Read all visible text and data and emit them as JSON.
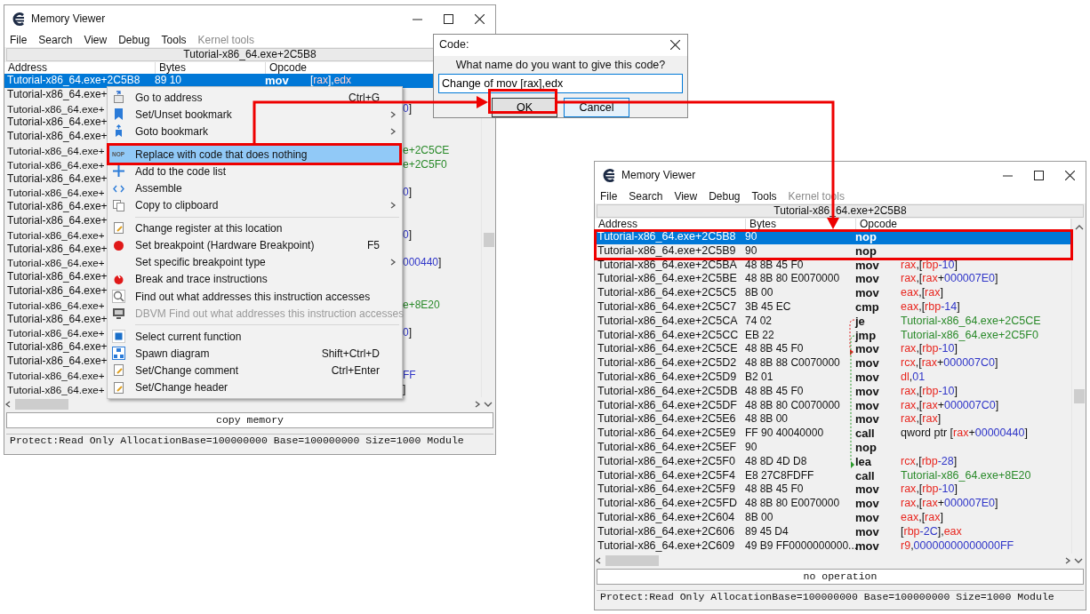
{
  "left_window": {
    "title": "Memory Viewer",
    "menu": [
      {
        "label": "File",
        "disabled": false
      },
      {
        "label": "Search",
        "disabled": false
      },
      {
        "label": "View",
        "disabled": false
      },
      {
        "label": "Debug",
        "disabled": false
      },
      {
        "label": "Tools",
        "disabled": false
      },
      {
        "label": "Kernel tools",
        "disabled": true
      }
    ],
    "address_bar": "Tutorial-x86_64.exe+2C5B8",
    "columns": [
      "Address",
      "Bytes",
      "Opcode"
    ],
    "rows": [
      {
        "address": "Tutorial-x86_64.exe+2C5B8",
        "bytes": "89 10",
        "opcode": "mov",
        "operand": [
          {
            "text": "[",
            "kind": "plain"
          },
          {
            "text": "rax",
            "kind": "reg"
          },
          {
            "text": "],",
            "kind": "plain"
          },
          {
            "text": "edx",
            "kind": "reg"
          }
        ],
        "selected": true
      },
      {
        "address": "Tutorial-x86_64.exe+",
        "selected": false
      },
      {
        "address": "Tutorial-x86_64.exe+",
        "tail": [
          {
            "text": "0",
            "kind": "num"
          },
          {
            "text": "]",
            "kind": "plain"
          }
        ],
        "selected": false
      },
      {
        "address": "Tutorial-x86_64.exe+",
        "selected": false
      },
      {
        "address": "Tutorial-x86_64.exe+",
        "selected": false
      },
      {
        "address": "Tutorial-x86_64.exe+",
        "tail": [
          {
            "text": "e+2C5CE",
            "kind": "label"
          }
        ],
        "selected": false
      },
      {
        "address": "Tutorial-x86_64.exe+",
        "tail": [
          {
            "text": "e+2C5F0",
            "kind": "label"
          }
        ],
        "selected": false
      },
      {
        "address": "Tutorial-x86_64.exe+",
        "selected": false
      },
      {
        "address": "Tutorial-x86_64.exe+",
        "tail": [
          {
            "text": "0",
            "kind": "num"
          },
          {
            "text": "]",
            "kind": "plain"
          }
        ],
        "selected": false
      },
      {
        "address": "Tutorial-x86_64.exe+",
        "selected": false
      },
      {
        "address": "Tutorial-x86_64.exe+",
        "selected": false
      },
      {
        "address": "Tutorial-x86_64.exe+",
        "tail": [
          {
            "text": "0",
            "kind": "num"
          },
          {
            "text": "]",
            "kind": "plain"
          }
        ],
        "selected": false
      },
      {
        "address": "Tutorial-x86_64.exe+",
        "selected": false
      },
      {
        "address": "Tutorial-x86_64.exe+",
        "tail": [
          {
            "text": "000440",
            "kind": "num"
          },
          {
            "text": "]",
            "kind": "plain"
          }
        ],
        "selected": false
      },
      {
        "address": "Tutorial-x86_64.exe+",
        "selected": false
      },
      {
        "address": "Tutorial-x86_64.exe+",
        "selected": false
      },
      {
        "address": "Tutorial-x86_64.exe+",
        "tail": [
          {
            "text": "e+8E20",
            "kind": "label"
          }
        ],
        "selected": false
      },
      {
        "address": "Tutorial-x86_64.exe+",
        "selected": false
      },
      {
        "address": "Tutorial-x86_64.exe+",
        "tail": [
          {
            "text": "0",
            "kind": "num"
          },
          {
            "text": "]",
            "kind": "plain"
          }
        ],
        "selected": false
      },
      {
        "address": "Tutorial-x86_64.exe+",
        "selected": false
      },
      {
        "address": "Tutorial-x86_64.exe+",
        "selected": false
      },
      {
        "address": "Tutorial-x86_64.exe+",
        "tail": [
          {
            "text": "FF",
            "kind": "num"
          }
        ],
        "selected": false
      },
      {
        "address": "Tutorial-x86_64.exe+",
        "tail": [
          {
            "text": "]",
            "kind": "plain"
          }
        ],
        "selected": false
      }
    ],
    "description": "copy memory",
    "status": "Protect:Read Only  AllocationBase=100000000 Base=100000000 Size=1000 Module"
  },
  "context_menu": [
    {
      "kind": "item",
      "label": "Go to address",
      "shortcut": "Ctrl+G",
      "submenu": false,
      "disabled": false,
      "selected": false
    },
    {
      "kind": "item",
      "label": "Set/Unset bookmark",
      "submenu": true,
      "disabled": false,
      "selected": false
    },
    {
      "kind": "item",
      "label": "Goto bookmark",
      "submenu": true,
      "disabled": false,
      "selected": false
    },
    {
      "kind": "separator"
    },
    {
      "kind": "item",
      "label": "Replace with code that does nothing",
      "icon_text": "NOP",
      "submenu": false,
      "disabled": false,
      "selected": true
    },
    {
      "kind": "item",
      "label": "Add to the code list",
      "submenu": false,
      "disabled": false,
      "selected": false
    },
    {
      "kind": "item",
      "label": "Assemble",
      "submenu": false,
      "disabled": false,
      "selected": false
    },
    {
      "kind": "item",
      "label": "Copy to clipboard",
      "submenu": true,
      "disabled": false,
      "selected": false
    },
    {
      "kind": "separator"
    },
    {
      "kind": "item",
      "label": "Change register at this location",
      "submenu": false,
      "disabled": false,
      "selected": false
    },
    {
      "kind": "item",
      "label": "Set breakpoint (Hardware Breakpoint)",
      "shortcut": "F5",
      "submenu": false,
      "disabled": false,
      "selected": false
    },
    {
      "kind": "item",
      "label": "Set specific breakpoint type",
      "submenu": true,
      "disabled": false,
      "selected": false
    },
    {
      "kind": "item",
      "label": "Break and trace instructions",
      "submenu": false,
      "disabled": false,
      "selected": false
    },
    {
      "kind": "item",
      "label": "Find out what addresses this instruction accesses",
      "submenu": false,
      "disabled": false,
      "selected": false
    },
    {
      "kind": "item",
      "label": "DBVM Find out what addresses this instruction accesses",
      "submenu": false,
      "disabled": true,
      "selected": false
    },
    {
      "kind": "separator"
    },
    {
      "kind": "item",
      "label": "Select current function",
      "submenu": false,
      "disabled": false,
      "selected": false
    },
    {
      "kind": "item",
      "label": "Spawn diagram",
      "shortcut": "Shift+Ctrl+D",
      "submenu": false,
      "disabled": false,
      "selected": false
    },
    {
      "kind": "item",
      "label": "Set/Change comment",
      "shortcut": "Ctrl+Enter",
      "submenu": false,
      "disabled": false,
      "selected": false
    },
    {
      "kind": "item",
      "label": "Set/Change header",
      "submenu": false,
      "disabled": false,
      "selected": false
    }
  ],
  "dialog": {
    "title": "Code:",
    "prompt": "What name do you want to give this code?",
    "value": "Change of mov [rax],edx",
    "buttons": [
      {
        "label": "OK",
        "default": true
      },
      {
        "label": "Cancel",
        "default": false
      }
    ]
  },
  "right_window": {
    "title": "Memory Viewer",
    "menu": [
      {
        "label": "File",
        "disabled": false
      },
      {
        "label": "Search",
        "disabled": false
      },
      {
        "label": "View",
        "disabled": false
      },
      {
        "label": "Debug",
        "disabled": false
      },
      {
        "label": "Tools",
        "disabled": false
      },
      {
        "label": "Kernel tools",
        "disabled": true
      }
    ],
    "address_bar": "Tutorial-x86_64.exe+2C5B8",
    "columns": [
      "Address",
      "Bytes",
      "Opcode"
    ],
    "rows": [
      {
        "address": "Tutorial-x86_64.exe+2C5B8",
        "bytes": "90",
        "opcode": "nop",
        "operand": [],
        "selected": true
      },
      {
        "address": "Tutorial-x86_64.exe+2C5B9",
        "bytes": "90",
        "opcode": "nop",
        "operand": [],
        "selected": false
      },
      {
        "address": "Tutorial-x86_64.exe+2C5BA",
        "bytes": "48 8B 45 F0",
        "opcode": "mov",
        "operand": [
          {
            "text": "rax",
            "kind": "reg"
          },
          {
            "text": ",[",
            "kind": "plain"
          },
          {
            "text": "rbp",
            "kind": "reg"
          },
          {
            "text": "-10",
            "kind": "num"
          },
          {
            "text": "]",
            "kind": "plain"
          }
        ],
        "selected": false
      },
      {
        "address": "Tutorial-x86_64.exe+2C5BE",
        "bytes": "48 8B 80 E0070000",
        "opcode": "mov",
        "operand": [
          {
            "text": "rax",
            "kind": "reg"
          },
          {
            "text": ",[",
            "kind": "plain"
          },
          {
            "text": "rax",
            "kind": "reg"
          },
          {
            "text": "+",
            "kind": "plain"
          },
          {
            "text": "000007E0",
            "kind": "num"
          },
          {
            "text": "]",
            "kind": "plain"
          }
        ],
        "selected": false
      },
      {
        "address": "Tutorial-x86_64.exe+2C5C5",
        "bytes": "8B 00",
        "opcode": "mov",
        "operand": [
          {
            "text": "eax",
            "kind": "reg"
          },
          {
            "text": ",[",
            "kind": "plain"
          },
          {
            "text": "rax",
            "kind": "reg"
          },
          {
            "text": "]",
            "kind": "plain"
          }
        ],
        "selected": false
      },
      {
        "address": "Tutorial-x86_64.exe+2C5C7",
        "bytes": "3B 45 EC",
        "opcode": "cmp",
        "operand": [
          {
            "text": "eax",
            "kind": "reg"
          },
          {
            "text": ",[",
            "kind": "plain"
          },
          {
            "text": "rbp",
            "kind": "reg"
          },
          {
            "text": "-14",
            "kind": "num"
          },
          {
            "text": "]",
            "kind": "plain"
          }
        ],
        "selected": false
      },
      {
        "address": "Tutorial-x86_64.exe+2C5CA",
        "bytes": "74 02",
        "opcode": "je",
        "operand": [
          {
            "text": "Tutorial-x86_64.exe+2C5CE",
            "kind": "label"
          }
        ],
        "selected": false
      },
      {
        "address": "Tutorial-x86_64.exe+2C5CC",
        "bytes": "EB 22",
        "opcode": "jmp",
        "operand": [
          {
            "text": "Tutorial-x86_64.exe+2C5F0",
            "kind": "label"
          }
        ],
        "selected": false
      },
      {
        "address": "Tutorial-x86_64.exe+2C5CE",
        "bytes": "48 8B 45 F0",
        "opcode": "mov",
        "operand": [
          {
            "text": "rax",
            "kind": "reg"
          },
          {
            "text": ",[",
            "kind": "plain"
          },
          {
            "text": "rbp",
            "kind": "reg"
          },
          {
            "text": "-10",
            "kind": "num"
          },
          {
            "text": "]",
            "kind": "plain"
          }
        ],
        "selected": false
      },
      {
        "address": "Tutorial-x86_64.exe+2C5D2",
        "bytes": "48 8B 88 C0070000",
        "opcode": "mov",
        "operand": [
          {
            "text": "rcx",
            "kind": "reg"
          },
          {
            "text": ",[",
            "kind": "plain"
          },
          {
            "text": "rax",
            "kind": "reg"
          },
          {
            "text": "+",
            "kind": "plain"
          },
          {
            "text": "000007C0",
            "kind": "num"
          },
          {
            "text": "]",
            "kind": "plain"
          }
        ],
        "selected": false
      },
      {
        "address": "Tutorial-x86_64.exe+2C5D9",
        "bytes": "B2 01",
        "opcode": "mov",
        "operand": [
          {
            "text": "dl",
            "kind": "reg"
          },
          {
            "text": ",",
            "kind": "plain"
          },
          {
            "text": "01",
            "kind": "num"
          }
        ],
        "selected": false
      },
      {
        "address": "Tutorial-x86_64.exe+2C5DB",
        "bytes": "48 8B 45 F0",
        "opcode": "mov",
        "operand": [
          {
            "text": "rax",
            "kind": "reg"
          },
          {
            "text": ",[",
            "kind": "plain"
          },
          {
            "text": "rbp",
            "kind": "reg"
          },
          {
            "text": "-10",
            "kind": "num"
          },
          {
            "text": "]",
            "kind": "plain"
          }
        ],
        "selected": false
      },
      {
        "address": "Tutorial-x86_64.exe+2C5DF",
        "bytes": "48 8B 80 C0070000",
        "opcode": "mov",
        "operand": [
          {
            "text": "rax",
            "kind": "reg"
          },
          {
            "text": ",[",
            "kind": "plain"
          },
          {
            "text": "rax",
            "kind": "reg"
          },
          {
            "text": "+",
            "kind": "plain"
          },
          {
            "text": "000007C0",
            "kind": "num"
          },
          {
            "text": "]",
            "kind": "plain"
          }
        ],
        "selected": false
      },
      {
        "address": "Tutorial-x86_64.exe+2C5E6",
        "bytes": "48 8B 00",
        "opcode": "mov",
        "operand": [
          {
            "text": "rax",
            "kind": "reg"
          },
          {
            "text": ",[",
            "kind": "plain"
          },
          {
            "text": "rax",
            "kind": "reg"
          },
          {
            "text": "]",
            "kind": "plain"
          }
        ],
        "selected": false
      },
      {
        "address": "Tutorial-x86_64.exe+2C5E9",
        "bytes": "FF 90 40040000",
        "opcode": "call",
        "operand": [
          {
            "text": "qword ptr [",
            "kind": "plain"
          },
          {
            "text": "rax",
            "kind": "reg"
          },
          {
            "text": "+",
            "kind": "plain"
          },
          {
            "text": "00000440",
            "kind": "num"
          },
          {
            "text": "]",
            "kind": "plain"
          }
        ],
        "selected": false
      },
      {
        "address": "Tutorial-x86_64.exe+2C5EF",
        "bytes": "90",
        "opcode": "nop",
        "operand": [],
        "selected": false
      },
      {
        "address": "Tutorial-x86_64.exe+2C5F0",
        "bytes": "48 8D 4D D8",
        "opcode": "lea",
        "operand": [
          {
            "text": "rcx",
            "kind": "reg"
          },
          {
            "text": ",[",
            "kind": "plain"
          },
          {
            "text": "rbp",
            "kind": "reg"
          },
          {
            "text": "-28",
            "kind": "num"
          },
          {
            "text": "]",
            "kind": "plain"
          }
        ],
        "selected": false
      },
      {
        "address": "Tutorial-x86_64.exe+2C5F4",
        "bytes": "E8 27C8FDFF",
        "opcode": "call",
        "operand": [
          {
            "text": "Tutorial-x86_64.exe+8E20",
            "kind": "label"
          }
        ],
        "selected": false
      },
      {
        "address": "Tutorial-x86_64.exe+2C5F9",
        "bytes": "48 8B 45 F0",
        "opcode": "mov",
        "operand": [
          {
            "text": "rax",
            "kind": "reg"
          },
          {
            "text": ",[",
            "kind": "plain"
          },
          {
            "text": "rbp",
            "kind": "reg"
          },
          {
            "text": "-10",
            "kind": "num"
          },
          {
            "text": "]",
            "kind": "plain"
          }
        ],
        "selected": false
      },
      {
        "address": "Tutorial-x86_64.exe+2C5FD",
        "bytes": "48 8B 80 E0070000",
        "opcode": "mov",
        "operand": [
          {
            "text": "rax",
            "kind": "reg"
          },
          {
            "text": ",[",
            "kind": "plain"
          },
          {
            "text": "rax",
            "kind": "reg"
          },
          {
            "text": "+",
            "kind": "plain"
          },
          {
            "text": "000007E0",
            "kind": "num"
          },
          {
            "text": "]",
            "kind": "plain"
          }
        ],
        "selected": false
      },
      {
        "address": "Tutorial-x86_64.exe+2C604",
        "bytes": "8B 00",
        "opcode": "mov",
        "operand": [
          {
            "text": "eax",
            "kind": "reg"
          },
          {
            "text": ",[",
            "kind": "plain"
          },
          {
            "text": "rax",
            "kind": "reg"
          },
          {
            "text": "]",
            "kind": "plain"
          }
        ],
        "selected": false
      },
      {
        "address": "Tutorial-x86_64.exe+2C606",
        "bytes": "89 45 D4",
        "opcode": "mov",
        "operand": [
          {
            "text": "[",
            "kind": "plain"
          },
          {
            "text": "rbp",
            "kind": "reg"
          },
          {
            "text": "-2C",
            "kind": "num"
          },
          {
            "text": "],",
            "kind": "plain"
          },
          {
            "text": "eax",
            "kind": "reg"
          }
        ],
        "selected": false
      },
      {
        "address": "Tutorial-x86_64.exe+2C609",
        "bytes": "49 B9 FF0000000000...",
        "opcode": "mov",
        "operand": [
          {
            "text": "r9",
            "kind": "reg"
          },
          {
            "text": ",",
            "kind": "plain"
          },
          {
            "text": "00000000000000FF",
            "kind": "num"
          }
        ],
        "selected": false
      }
    ],
    "description": "no operation",
    "status": "Protect:Read Only  AllocationBase=100000000 Base=100000000 Size=1000 Module"
  }
}
